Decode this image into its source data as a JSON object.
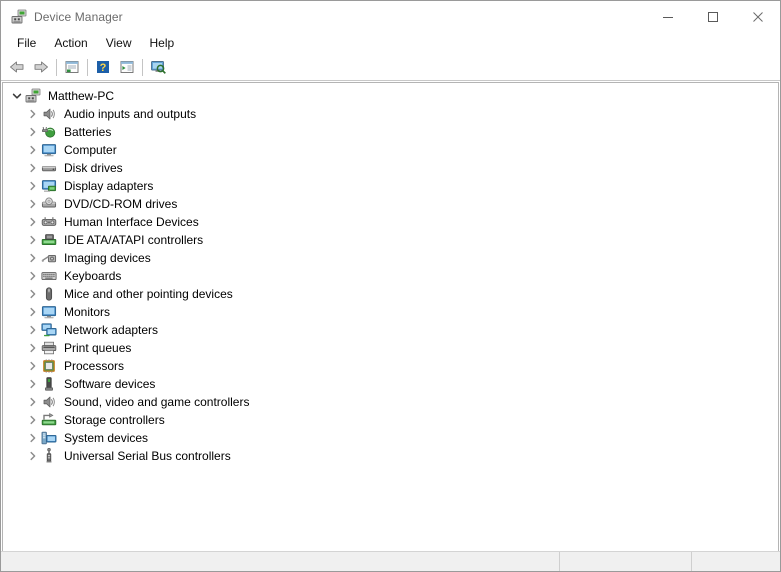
{
  "window": {
    "title": "Device Manager",
    "icon": "device-manager-icon",
    "controls": {
      "minimize": "minimize-icon",
      "maximize": "maximize-icon",
      "close": "close-icon"
    }
  },
  "menubar": {
    "items": [
      {
        "label": "File"
      },
      {
        "label": "Action"
      },
      {
        "label": "View"
      },
      {
        "label": "Help"
      }
    ]
  },
  "toolbar": {
    "buttons": [
      {
        "name": "back-icon",
        "title": "Back"
      },
      {
        "name": "forward-icon",
        "title": "Forward"
      },
      {
        "name": "properties-icon",
        "title": "Properties"
      },
      {
        "name": "help-icon",
        "title": "Help"
      },
      {
        "name": "show-hidden-devices-icon",
        "title": "Show hidden devices"
      },
      {
        "name": "scan-for-hardware-changes-icon",
        "title": "Scan for hardware changes"
      }
    ]
  },
  "tree": {
    "root": {
      "label": "Matthew-PC",
      "expanded": true,
      "chevron": "chevron-down-icon",
      "icon": "computer-root-icon"
    },
    "nodes": [
      {
        "label": "Audio inputs and outputs",
        "icon": "speaker-icon",
        "chevron": "chevron-right-icon"
      },
      {
        "label": "Batteries",
        "icon": "battery-icon",
        "chevron": "chevron-right-icon"
      },
      {
        "label": "Computer",
        "icon": "monitor-icon",
        "chevron": "chevron-right-icon"
      },
      {
        "label": "Disk drives",
        "icon": "disk-drive-icon",
        "chevron": "chevron-right-icon"
      },
      {
        "label": "Display adapters",
        "icon": "display-adapter-icon",
        "chevron": "chevron-right-icon"
      },
      {
        "label": "DVD/CD-ROM drives",
        "icon": "optical-drive-icon",
        "chevron": "chevron-right-icon"
      },
      {
        "label": "Human Interface Devices",
        "icon": "hid-icon",
        "chevron": "chevron-right-icon"
      },
      {
        "label": "IDE ATA/ATAPI controllers",
        "icon": "ide-controller-icon",
        "chevron": "chevron-right-icon"
      },
      {
        "label": "Imaging devices",
        "icon": "imaging-device-icon",
        "chevron": "chevron-right-icon"
      },
      {
        "label": "Keyboards",
        "icon": "keyboard-icon",
        "chevron": "chevron-right-icon"
      },
      {
        "label": "Mice and other pointing devices",
        "icon": "mouse-icon",
        "chevron": "chevron-right-icon"
      },
      {
        "label": "Monitors",
        "icon": "monitor-icon",
        "chevron": "chevron-right-icon"
      },
      {
        "label": "Network adapters",
        "icon": "network-adapter-icon",
        "chevron": "chevron-right-icon"
      },
      {
        "label": "Print queues",
        "icon": "printer-icon",
        "chevron": "chevron-right-icon"
      },
      {
        "label": "Processors",
        "icon": "processor-icon",
        "chevron": "chevron-right-icon"
      },
      {
        "label": "Software devices",
        "icon": "software-device-icon",
        "chevron": "chevron-right-icon"
      },
      {
        "label": "Sound, video and game controllers",
        "icon": "speaker-icon",
        "chevron": "chevron-right-icon"
      },
      {
        "label": "Storage controllers",
        "icon": "storage-controller-icon",
        "chevron": "chevron-right-icon"
      },
      {
        "label": "System devices",
        "icon": "system-device-icon",
        "chevron": "chevron-right-icon"
      },
      {
        "label": "Universal Serial Bus controllers",
        "icon": "usb-icon",
        "chevron": "chevron-right-icon"
      }
    ]
  },
  "statusbar": {
    "main": "",
    "middle": "",
    "end": ""
  },
  "colors": {
    "title_text": "#6b6b6b",
    "window_bg": "#ffffff",
    "statusbar_bg": "#f0f0f0",
    "border": "#b4b4b4",
    "icon_blue": "#4a90c4",
    "icon_green": "#5aa832",
    "icon_gray": "#6e6e6e"
  }
}
